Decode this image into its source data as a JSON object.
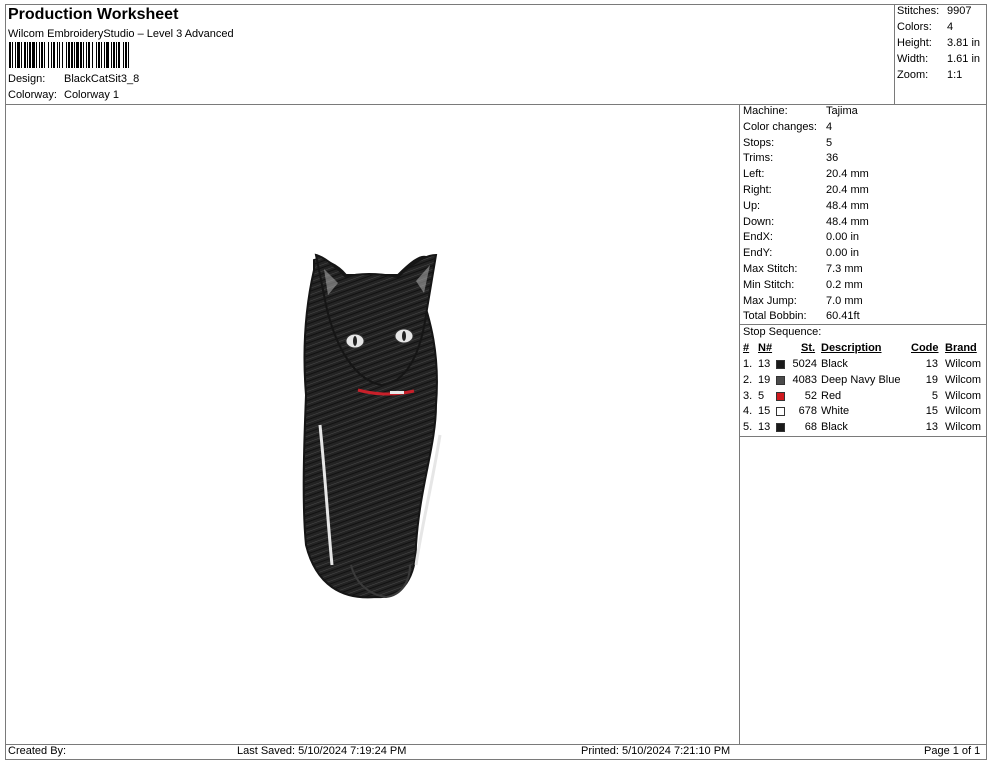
{
  "header": {
    "title": "Production Worksheet",
    "subtitle": "Wilcom EmbroideryStudio – Level 3 Advanced",
    "design_label": "Design:",
    "design_value": "BlackCatSit3_8",
    "colorway_label": "Colorway:",
    "colorway_value": "Colorway 1"
  },
  "stats": [
    {
      "label": "Stitches:",
      "value": "9907"
    },
    {
      "label": "Colors:",
      "value": "4"
    },
    {
      "label": "Height:",
      "value": "3.81 in"
    },
    {
      "label": "Width:",
      "value": "1.61 in"
    },
    {
      "label": "Zoom:",
      "value": "1:1"
    }
  ],
  "machine_info": [
    {
      "label": "Machine:",
      "value": "Tajima"
    },
    {
      "label": "Color changes:",
      "value": "4"
    },
    {
      "label": "Stops:",
      "value": "5"
    },
    {
      "label": "Trims:",
      "value": "36"
    },
    {
      "label": "Left:",
      "value": "20.4 mm"
    },
    {
      "label": "Right:",
      "value": "20.4 mm"
    },
    {
      "label": "Up:",
      "value": "48.4 mm"
    },
    {
      "label": "Down:",
      "value": "48.4 mm"
    },
    {
      "label": "EndX:",
      "value": "0.00 in"
    },
    {
      "label": "EndY:",
      "value": "0.00 in"
    },
    {
      "label": "Max Stitch:",
      "value": "7.3 mm"
    },
    {
      "label": "Min Stitch:",
      "value": "0.2 mm"
    },
    {
      "label": "Max Jump:",
      "value": "7.0 mm"
    },
    {
      "label": "Total Bobbin:",
      "value": "60.41ft"
    }
  ],
  "stop_sequence": {
    "title": "Stop Sequence:",
    "headers": {
      "num": "#",
      "n": "N#",
      "st": "St.",
      "description": "Description",
      "code": "Code",
      "brand": "Brand"
    },
    "rows": [
      {
        "num": "1.",
        "n": "13",
        "color": "#1a1a1a",
        "st": "5024",
        "description": "Black",
        "code": "13",
        "brand": "Wilcom"
      },
      {
        "num": "2.",
        "n": "19",
        "color": "#4a4a4a",
        "st": "4083",
        "description": "Deep Navy Blue",
        "code": "19",
        "brand": "Wilcom"
      },
      {
        "num": "3.",
        "n": "5",
        "color": "#d0191e",
        "st": "52",
        "description": "Red",
        "code": "5",
        "brand": "Wilcom"
      },
      {
        "num": "4.",
        "n": "15",
        "color": "#ffffff",
        "st": "678",
        "description": "White",
        "code": "15",
        "brand": "Wilcom"
      },
      {
        "num": "5.",
        "n": "13",
        "color": "#1a1a1a",
        "st": "68",
        "description": "Black",
        "code": "13",
        "brand": "Wilcom"
      }
    ]
  },
  "footer": {
    "created_by": "Created By:",
    "last_saved": "Last Saved: 5/10/2024 7:19:24 PM",
    "printed": "Printed: 5/10/2024 7:21:10 PM",
    "page": "Page 1 of 1"
  }
}
